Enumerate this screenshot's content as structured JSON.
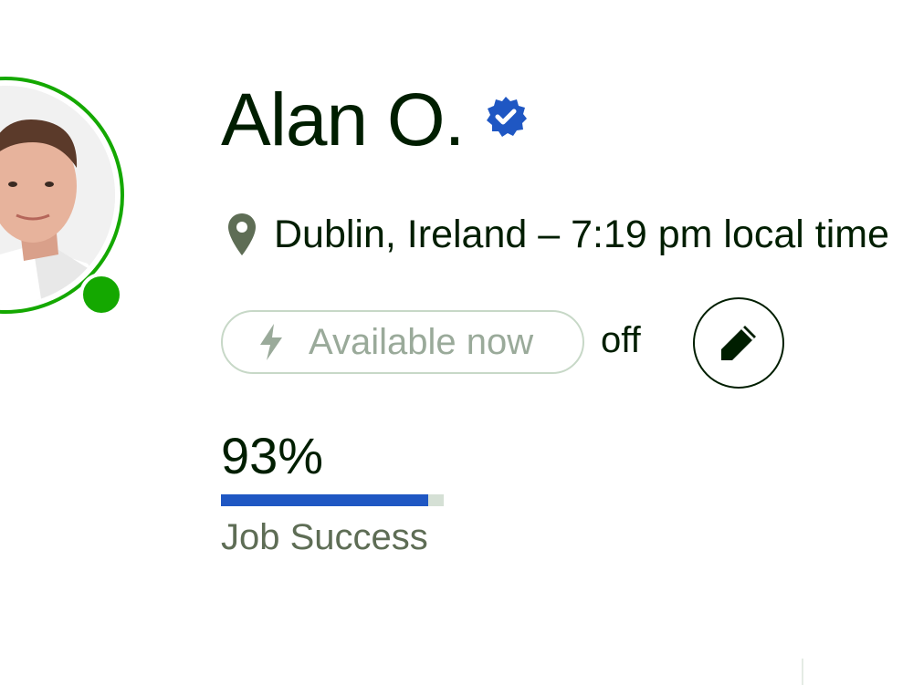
{
  "profile": {
    "name": "Alan O.",
    "verified_icon": "verified-badge-icon",
    "location": "Dublin, Ireland – 7:19 pm local time",
    "location_icon": "map-pin-icon"
  },
  "availability": {
    "label": "Available now",
    "state": "off",
    "icon": "lightning-bolt-icon",
    "edit_icon": "pencil-icon"
  },
  "job_success": {
    "value_text": "93%",
    "percent": 93,
    "label": "Job Success"
  },
  "colors": {
    "online": "#14a800",
    "verified": "#1f57c3",
    "progress": "#1f57c3",
    "progress_track": "#d5e0d5",
    "text": "#001e00"
  }
}
